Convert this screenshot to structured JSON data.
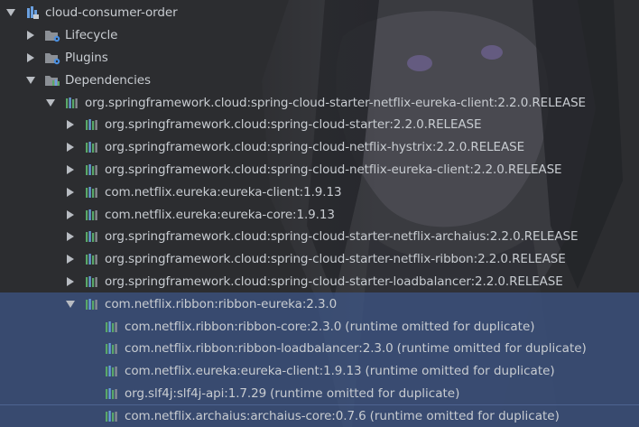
{
  "tree": {
    "root": {
      "label": "cloud-consumer-order",
      "icon": "maven-module-icon"
    },
    "lifecycle": {
      "label": "Lifecycle",
      "icon": "folder-gear-icon"
    },
    "plugins": {
      "label": "Plugins",
      "icon": "folder-gear-icon"
    },
    "dependencies": {
      "label": "Dependencies",
      "icon": "library-folder-icon"
    },
    "eureka_starter": {
      "label": "org.springframework.cloud:spring-cloud-starter-netflix-eureka-client:2.2.0.RELEASE",
      "icon": "library-icon"
    },
    "children": [
      {
        "label": "org.springframework.cloud:spring-cloud-starter:2.2.0.RELEASE"
      },
      {
        "label": "org.springframework.cloud:spring-cloud-netflix-hystrix:2.2.0.RELEASE"
      },
      {
        "label": "org.springframework.cloud:spring-cloud-netflix-eureka-client:2.2.0.RELEASE"
      },
      {
        "label": "com.netflix.eureka:eureka-client:1.9.13"
      },
      {
        "label": "com.netflix.eureka:eureka-core:1.9.13"
      },
      {
        "label": "org.springframework.cloud:spring-cloud-starter-netflix-archaius:2.2.0.RELEASE"
      },
      {
        "label": "org.springframework.cloud:spring-cloud-starter-netflix-ribbon:2.2.0.RELEASE"
      },
      {
        "label": "org.springframework.cloud:spring-cloud-starter-loadbalancer:2.2.0.RELEASE"
      }
    ],
    "ribbon_eureka": {
      "label": "com.netflix.ribbon:ribbon-eureka:2.3.0"
    },
    "ribbon_children": [
      {
        "label": "com.netflix.ribbon:ribbon-core:2.3.0",
        "note": "(runtime omitted for duplicate)"
      },
      {
        "label": "com.netflix.ribbon:ribbon-loadbalancer:2.3.0",
        "note": "(runtime omitted for duplicate)"
      },
      {
        "label": "com.netflix.eureka:eureka-client:1.9.13",
        "note": "(runtime omitted for duplicate)"
      },
      {
        "label": "org.slf4j:slf4j-api:1.7.29",
        "note": "(runtime omitted for duplicate)"
      },
      {
        "label": "com.netflix.archaius:archaius-core:0.7.6",
        "note": "(runtime omitted for duplicate)"
      }
    ]
  },
  "colors": {
    "background": "#2c2d30",
    "selection": "#3d5688",
    "text": "#c8ccd1",
    "library_green": "#59a869",
    "library_blue": "#6aa0e0"
  }
}
